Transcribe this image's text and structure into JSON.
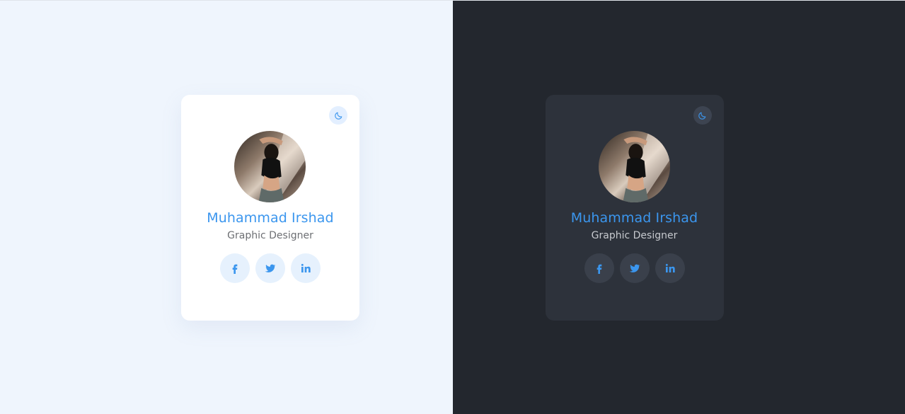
{
  "colors": {
    "light_background": "#eff5fd",
    "dark_background": "#23272e",
    "light_card": "#ffffff",
    "dark_card": "#2d323b",
    "accent": "#3b96ee"
  },
  "light_card": {
    "theme_toggle_icon": "moon-icon",
    "avatar_alt": "profile-photo",
    "name": "Muhammad Irshad",
    "role": "Graphic Designer",
    "socials": [
      {
        "icon": "facebook-icon"
      },
      {
        "icon": "twitter-icon"
      },
      {
        "icon": "linkedin-icon"
      }
    ]
  },
  "dark_card": {
    "theme_toggle_icon": "moon-icon",
    "avatar_alt": "profile-photo",
    "name": "Muhammad Irshad",
    "role": "Graphic Designer",
    "socials": [
      {
        "icon": "facebook-icon"
      },
      {
        "icon": "twitter-icon"
      },
      {
        "icon": "linkedin-icon"
      }
    ]
  }
}
